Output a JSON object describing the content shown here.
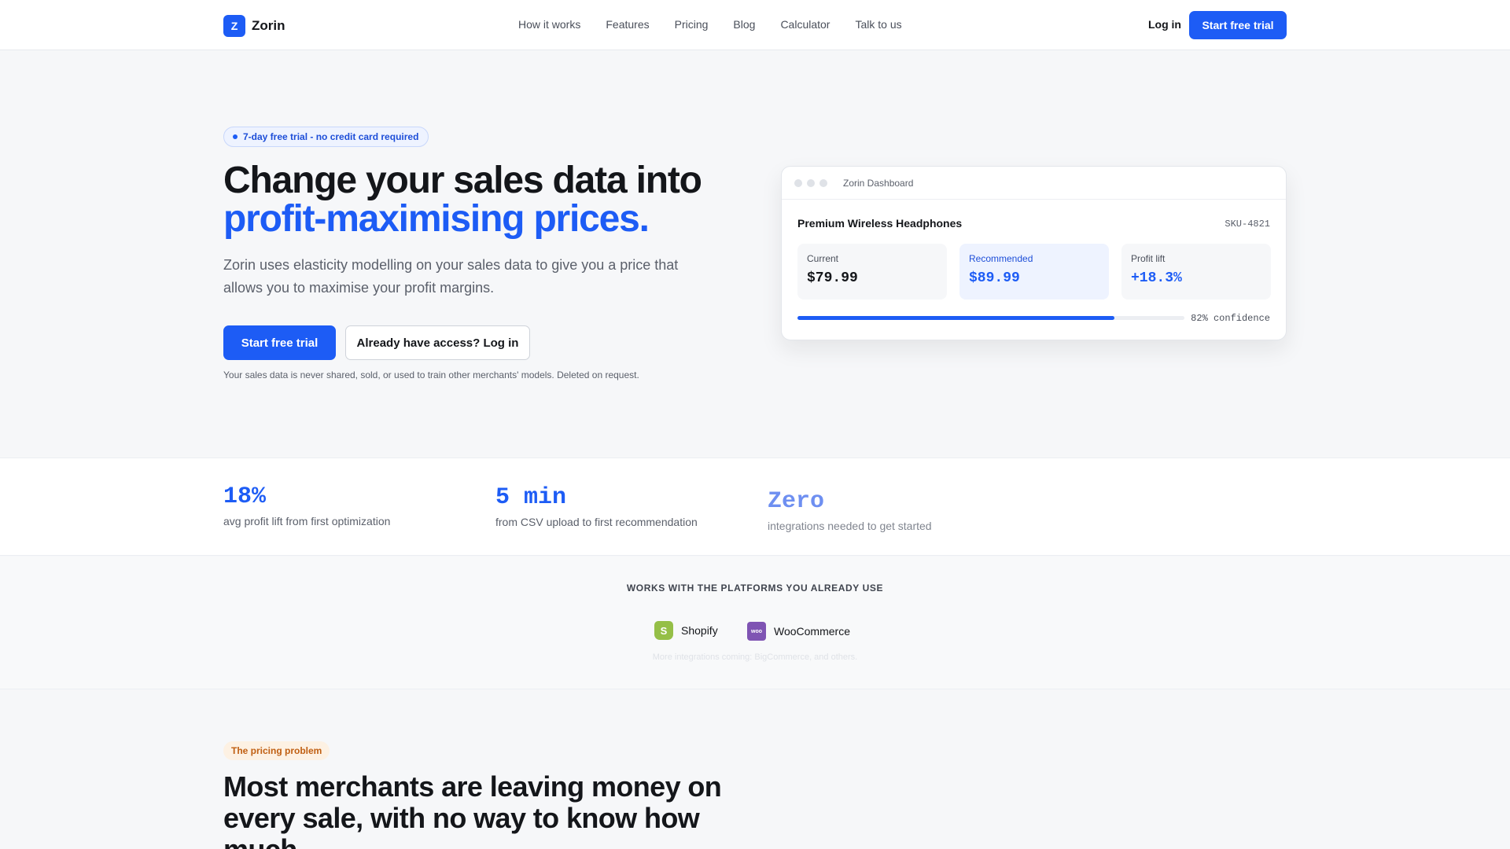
{
  "nav": {
    "logo_mark": "Z",
    "logo_text": "Zorin",
    "links": [
      "How it works",
      "Features",
      "Pricing",
      "Blog",
      "Calculator",
      "Talk to us"
    ],
    "login": "Log in",
    "cta": "Start free trial"
  },
  "hero": {
    "badge": "7-day free trial - no credit card required",
    "title_line1": "Change your sales data into",
    "title_line2": "profit-maximising prices.",
    "subtitle": "Zorin uses elasticity modelling on your sales data to give you a price that allows you to maximise your profit margins.",
    "primary_button": "Start free trial",
    "secondary_button": "Already have access? Log in",
    "privacy_note": "Your sales data is never shared, sold, or used to train other merchants' models. Deleted on request."
  },
  "dashboard": {
    "window_title": "Zorin Dashboard",
    "product": "Premium Wireless Headphones",
    "sku": "SKU-4821",
    "current_label": "Current",
    "current_value": "$79.99",
    "recommended_label": "Recommended",
    "recommended_value": "$89.99",
    "lift_label": "Profit lift",
    "lift_value": "+18.3%",
    "confidence_text": "82% confidence",
    "confidence_value": 0.82
  },
  "stats": [
    {
      "value": "18%",
      "label": "avg profit lift from first optimization"
    },
    {
      "value": "5 min",
      "label": "from CSV upload to first recommendation"
    },
    {
      "value": "Zero",
      "label": "integrations needed to get started"
    }
  ],
  "platforms": {
    "title": "WORKS WITH THE PLATFORMS YOU ALREADY USE",
    "items": [
      {
        "name": "Shopify",
        "icon": "shopify-icon",
        "glyph": "S"
      },
      {
        "name": "WooCommerce",
        "icon": "woocommerce-icon",
        "glyph": "woo"
      }
    ],
    "note": "More integrations coming: BigCommerce, and others."
  },
  "problem": {
    "tag": "The pricing problem",
    "title": "Most merchants are leaving money on every sale, with no way to know how much."
  },
  "colors": {
    "accent": "#1d5cf5",
    "background": "#f6f7f9",
    "text": "#14161a",
    "shopify": "#95bf47",
    "woocommerce": "#7f54b3",
    "tag_orange": "#c05f12"
  }
}
